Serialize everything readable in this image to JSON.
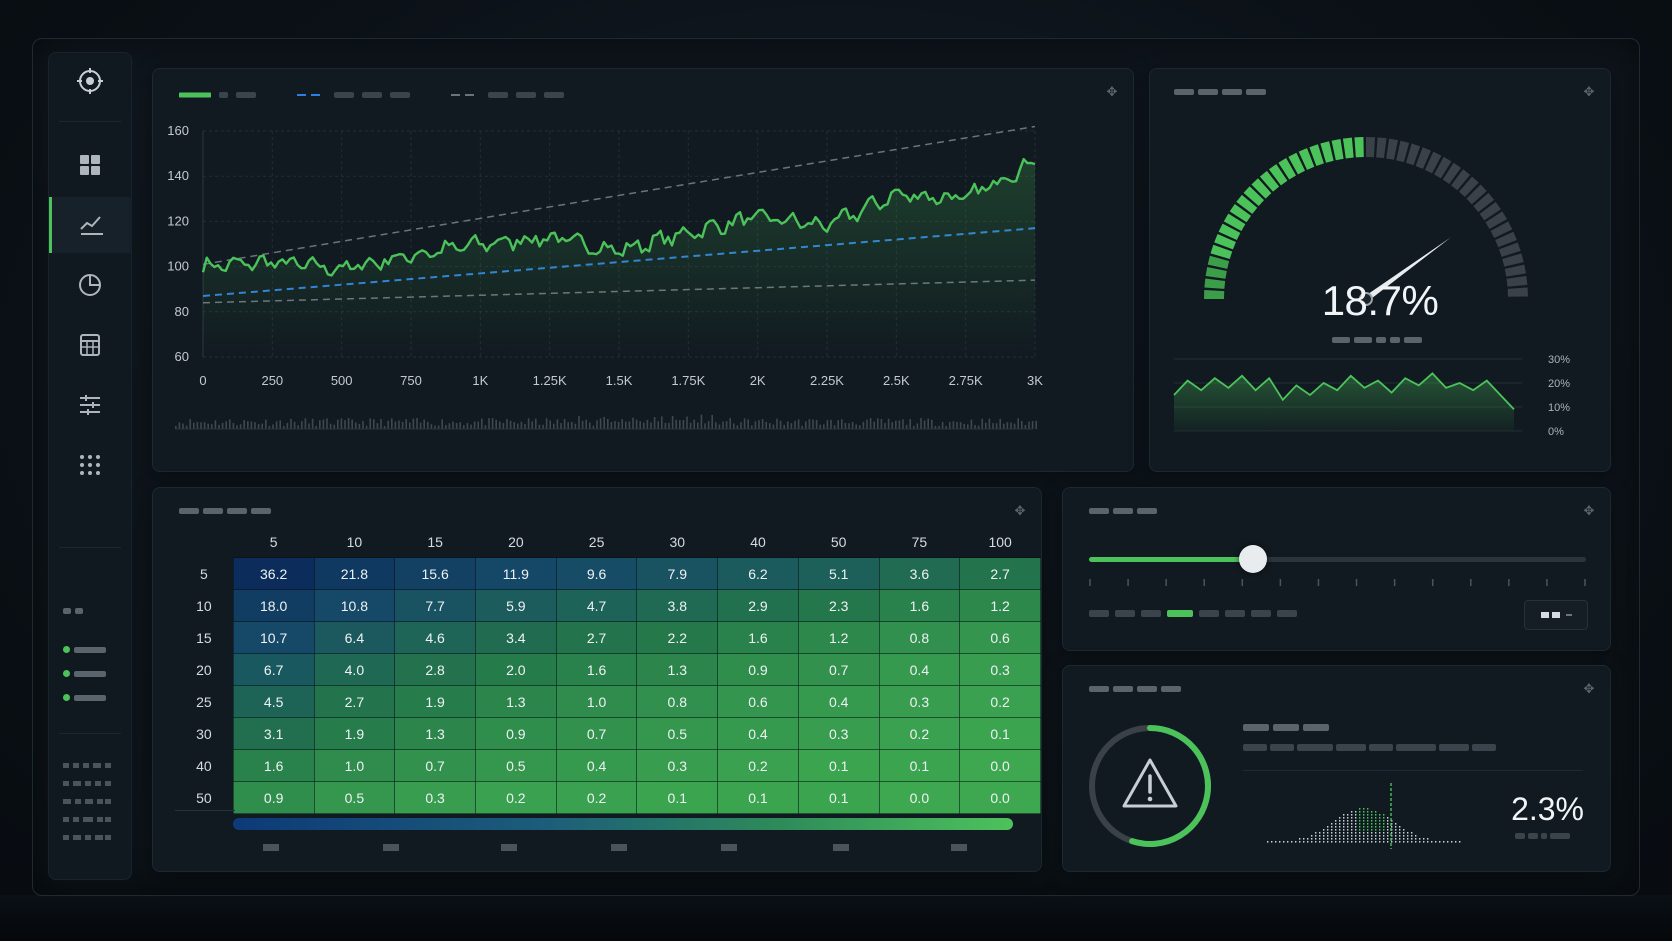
{
  "colors": {
    "accent_green": "#4cc35a",
    "accent_blue": "#2f7fe0",
    "dashed_gray": "#6b747c",
    "panel_bg": "#111a21"
  },
  "sidebar": {
    "items": [
      {
        "icon": "target-icon"
      },
      {
        "icon": "dashboard-grid-icon"
      },
      {
        "icon": "line-chart-icon",
        "active": true
      },
      {
        "icon": "pie-chart-icon"
      },
      {
        "icon": "calculator-icon"
      },
      {
        "icon": "sliders-icon"
      },
      {
        "icon": "apps-grid-icon"
      }
    ]
  },
  "main_chart": {
    "legend": [
      {
        "style": "solid",
        "color": "#4cc35a"
      },
      {
        "style": "dashed",
        "color": "#2f7fe0"
      },
      {
        "style": "dashed",
        "color": "#6b747c"
      }
    ]
  },
  "chart_data": [
    {
      "type": "line",
      "x_ticks": [
        "0",
        "250",
        "500",
        "750",
        "1K",
        "1.25K",
        "1.5K",
        "1.75K",
        "2K",
        "2.25K",
        "2.5K",
        "2.75K",
        "3K"
      ],
      "y_ticks": [
        "60",
        "80",
        "100",
        "120",
        "140",
        "160"
      ],
      "xlim": [
        0,
        3000
      ],
      "ylim": [
        60,
        160
      ],
      "grid": true,
      "series": [
        {
          "style": "solid",
          "color": "#4cc35a",
          "x": [
            0,
            250,
            500,
            750,
            1000,
            1250,
            1500,
            1750,
            2000,
            2250,
            2500,
            2750,
            3000
          ],
          "values": [
            100,
            102,
            99,
            105,
            110,
            113,
            107,
            115,
            122,
            118,
            132,
            130,
            147
          ]
        },
        {
          "style": "dashed",
          "color": "#2f7fe0",
          "x": [
            0,
            3000
          ],
          "values": [
            87,
            117
          ]
        },
        {
          "style": "dashed",
          "color": "#6b747c",
          "x": [
            0,
            3000
          ],
          "values": [
            101,
            162
          ]
        },
        {
          "style": "dashed",
          "color": "#6b747c",
          "x": [
            0,
            3000
          ],
          "values": [
            84,
            94
          ]
        }
      ]
    },
    {
      "type": "area",
      "y_ticks": [
        "0%",
        "10%",
        "20%",
        "30%"
      ],
      "ylim": [
        0,
        30
      ],
      "series": [
        {
          "color": "#4cc35a",
          "values": [
            15,
            21,
            17,
            22,
            18,
            23,
            17,
            22,
            13,
            19,
            15,
            20,
            17,
            23,
            18,
            21,
            16,
            22,
            19,
            24,
            18,
            20,
            17,
            21,
            15,
            9
          ]
        }
      ]
    },
    {
      "type": "heatmap",
      "col_headers": [
        "5",
        "10",
        "15",
        "20",
        "25",
        "30",
        "40",
        "50",
        "75",
        "100"
      ],
      "row_headers": [
        "5",
        "10",
        "15",
        "20",
        "25",
        "30",
        "40",
        "50"
      ],
      "values": [
        [
          "36.2",
          "21.8",
          "15.6",
          "11.9",
          "9.6",
          "7.9",
          "6.2",
          "5.1",
          "3.6",
          "2.7"
        ],
        [
          "18.0",
          "10.8",
          "7.7",
          "5.9",
          "4.7",
          "3.8",
          "2.9",
          "2.3",
          "1.6",
          "1.2"
        ],
        [
          "10.7",
          "6.4",
          "4.6",
          "3.4",
          "2.7",
          "2.2",
          "1.6",
          "1.2",
          "0.8",
          "0.6"
        ],
        [
          "6.7",
          "4.0",
          "2.8",
          "2.0",
          "1.6",
          "1.3",
          "0.9",
          "0.7",
          "0.4",
          "0.3"
        ],
        [
          "4.5",
          "2.7",
          "1.9",
          "1.3",
          "1.0",
          "0.8",
          "0.6",
          "0.4",
          "0.3",
          "0.2"
        ],
        [
          "3.1",
          "1.9",
          "1.3",
          "0.9",
          "0.7",
          "0.5",
          "0.4",
          "0.3",
          "0.2",
          "0.1"
        ],
        [
          "1.6",
          "1.0",
          "0.7",
          "0.5",
          "0.4",
          "0.3",
          "0.2",
          "0.1",
          "0.1",
          "0.0"
        ],
        [
          "0.9",
          "0.5",
          "0.3",
          "0.2",
          "0.2",
          "0.1",
          "0.1",
          "0.1",
          "0.0",
          "0.0"
        ]
      ]
    }
  ],
  "gauge": {
    "value_text": "18.7%",
    "fill_fraction": 0.5,
    "needle_fraction": 0.8
  },
  "slider": {
    "fraction": 0.33,
    "tick_count": 14
  },
  "alert": {
    "icon": "warning-icon",
    "ring_fraction": 0.55,
    "value_text": "2.3%"
  }
}
